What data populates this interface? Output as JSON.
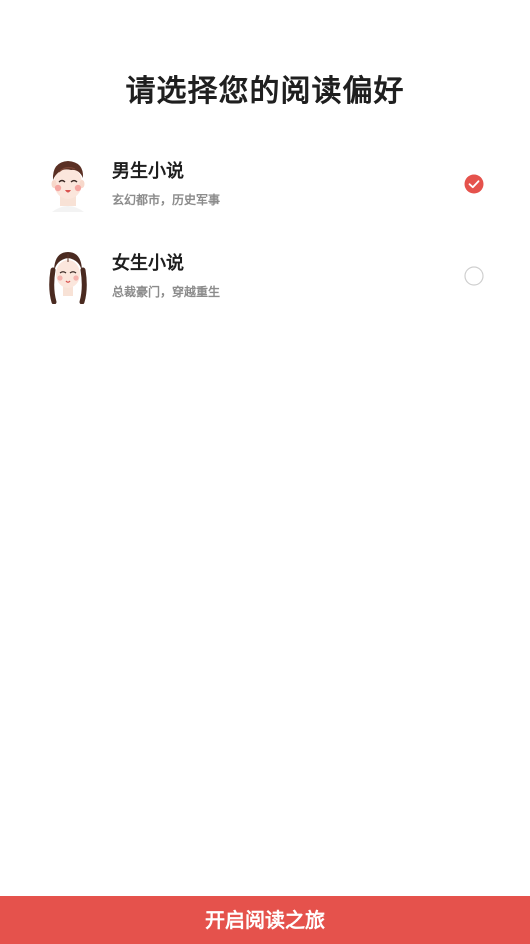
{
  "header": {
    "title": "请选择您的阅读偏好"
  },
  "options": [
    {
      "title": "男生小说",
      "subtitle": "玄幻都市，历史军事",
      "selected": true,
      "avatar_icon": "boy-avatar-icon"
    },
    {
      "title": "女生小说",
      "subtitle": "总裁豪门，穿越重生",
      "selected": false,
      "avatar_icon": "girl-avatar-icon"
    }
  ],
  "footer": {
    "button_label": "开启阅读之旅"
  },
  "colors": {
    "accent": "#e5524c",
    "radio_border": "#cfcfcf",
    "subtitle": "#8c8c8c",
    "title": "#1f1f1f"
  }
}
